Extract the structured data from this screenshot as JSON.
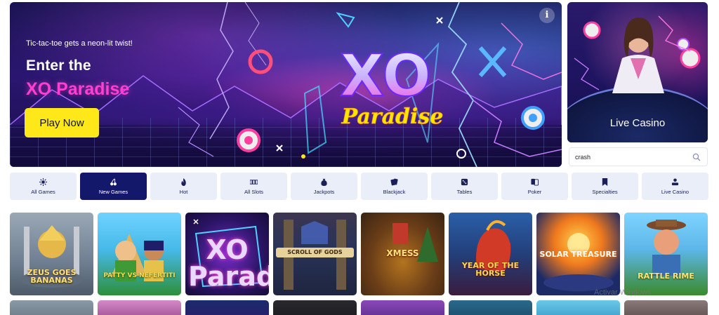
{
  "hero": {
    "tagline": "Tic-tac-toe gets a neon-lit twist!",
    "title_line1": "Enter the",
    "title_line2": "XO Paradise",
    "play_label": "Play Now",
    "info_label": "i",
    "logo_main": "XO",
    "logo_script": "Paradise",
    "colors": {
      "button": "#ffe81a",
      "title_accent": "#ff3fd0"
    }
  },
  "live_casino": {
    "label": "Live Casino"
  },
  "search": {
    "value": "crash",
    "icon": "search-icon"
  },
  "tabs": [
    {
      "label": "All Games",
      "icon": "star-burst-icon"
    },
    {
      "label": "New Games",
      "icon": "cherries-icon",
      "active": true
    },
    {
      "label": "Hot",
      "icon": "flame-icon"
    },
    {
      "label": "All Slots",
      "icon": "slot-reels-icon"
    },
    {
      "label": "Jackpots",
      "icon": "money-bag-icon"
    },
    {
      "label": "Blackjack",
      "icon": "cards-icon"
    },
    {
      "label": "Tables",
      "icon": "dice-icon"
    },
    {
      "label": "Poker",
      "icon": "poker-cards-icon"
    },
    {
      "label": "Specialties",
      "icon": "bookmark-icon"
    },
    {
      "label": "Live Casino",
      "icon": "dealer-icon"
    }
  ],
  "games": [
    {
      "title": "ZEUS GOES BANANAS"
    },
    {
      "title": "PATTY VS NEFERTITI"
    },
    {
      "title": "XO Paradise"
    },
    {
      "title": "SCROLL OF GODS"
    },
    {
      "title": "XMESS"
    },
    {
      "title": "YEAR OF THE HORSE"
    },
    {
      "title": "SOLAR TREASURE"
    },
    {
      "title": "RATTLE RIME"
    }
  ],
  "watermark": "Activar Windows"
}
